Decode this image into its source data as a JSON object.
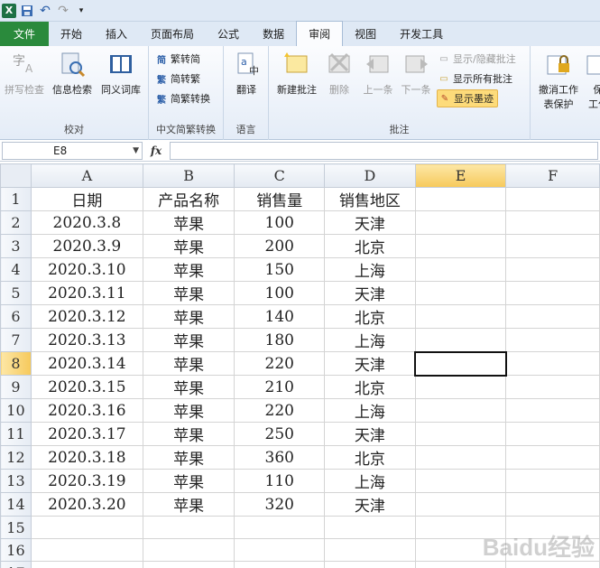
{
  "qat": {
    "excel_logo": "X",
    "undo": "↶",
    "redo": "↷"
  },
  "tabs": [
    {
      "label": "文件"
    },
    {
      "label": "开始"
    },
    {
      "label": "插入"
    },
    {
      "label": "页面布局"
    },
    {
      "label": "公式"
    },
    {
      "label": "数据"
    },
    {
      "label": "审阅"
    },
    {
      "label": "视图"
    },
    {
      "label": "开发工具"
    }
  ],
  "ribbon": {
    "proofing": {
      "label": "校对",
      "spell": "拼写检查",
      "research": "信息检索",
      "thesaurus": "同义词库"
    },
    "chinese": {
      "label": "中文简繁转换",
      "to_simplified": "繁转简",
      "to_traditional": "简转繁",
      "convert": "简繁转换"
    },
    "language": {
      "label": "语言",
      "translate": "翻译"
    },
    "comments": {
      "label": "批注",
      "new": "新建批注",
      "delete": "删除",
      "prev": "上一条",
      "next": "下一条",
      "show_hide": "显示/隐藏批注",
      "show_all": "显示所有批注",
      "show_ink": "显示墨迹"
    },
    "changes": {
      "unprotect_1": "撤消工作",
      "unprotect_2": "表保护",
      "protect_1": "保",
      "protect_2": "工作"
    }
  },
  "formula_bar": {
    "name_box": "E8",
    "fx": "fx",
    "value": ""
  },
  "columns": [
    "A",
    "B",
    "C",
    "D",
    "E",
    "F"
  ],
  "rows": [
    [
      "日期",
      "产品名称",
      "销售量",
      "销售地区"
    ],
    [
      "2020.3.8",
      "苹果",
      "100",
      "天津"
    ],
    [
      "2020.3.9",
      "苹果",
      "200",
      "北京"
    ],
    [
      "2020.3.10",
      "苹果",
      "150",
      "上海"
    ],
    [
      "2020.3.11",
      "苹果",
      "100",
      "天津"
    ],
    [
      "2020.3.12",
      "苹果",
      "140",
      "北京"
    ],
    [
      "2020.3.13",
      "苹果",
      "180",
      "上海"
    ],
    [
      "2020.3.14",
      "苹果",
      "220",
      "天津"
    ],
    [
      "2020.3.15",
      "苹果",
      "210",
      "北京"
    ],
    [
      "2020.3.16",
      "苹果",
      "220",
      "上海"
    ],
    [
      "2020.3.17",
      "苹果",
      "250",
      "天津"
    ],
    [
      "2020.3.18",
      "苹果",
      "360",
      "北京"
    ],
    [
      "2020.3.19",
      "苹果",
      "110",
      "上海"
    ],
    [
      "2020.3.20",
      "苹果",
      "320",
      "天津"
    ],
    [
      "",
      "",
      "",
      ""
    ],
    [
      "",
      "",
      "",
      ""
    ],
    [
      "",
      "",
      "",
      ""
    ]
  ],
  "selected_cell": {
    "col": "E",
    "row": 8
  },
  "watermark": "Baidu经验"
}
